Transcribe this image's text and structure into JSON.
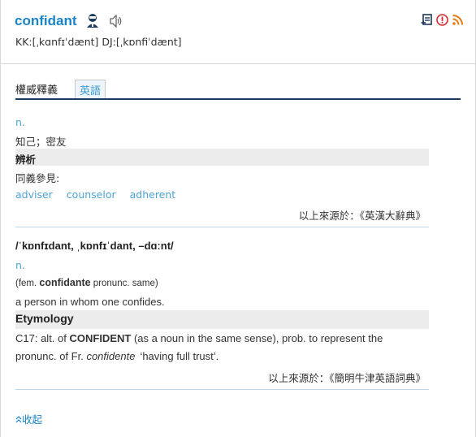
{
  "header": {
    "word": "confidant",
    "pronunciation": "KK:[ˌkɑnfɪˈdænt] DJ:[ˌkɒnfiˈdænt]",
    "icons": [
      "person-voice-icon",
      "speaker-icon",
      "add-to-list-icon",
      "report-icon",
      "rss-icon"
    ],
    "accent": "#1a84c7"
  },
  "tabs": {
    "active": "權威釋義",
    "english": "英語"
  },
  "entry1": {
    "pos": "n.",
    "definition": "知己；密友",
    "section_label": "辨析",
    "syn_label": "同義參見:",
    "synonyms": [
      "adviser",
      "counselor",
      "adherent"
    ],
    "source": "以上來源於：《英漢大辭典》"
  },
  "entry2": {
    "ipa": "/ˈkɒnfɪdant, ˌkɒnfɪˈdant, –dɑːnt/",
    "pos": "n.",
    "fem_open": "(fem. ",
    "fem_word": "confidante",
    "fem_close": " pronunc. same)",
    "definition": "a person in whom one confides.",
    "etym_label": "Etymology",
    "etym_p1": "C17: alt. of ",
    "etym_p2": "CONFIDENT",
    "etym_p3": " (as a noun in the same sense), prob. to represent the",
    "etym_p4": "pronunc. of Fr. ",
    "etym_p5": "confidente",
    "etym_p6": "‘having full trust’.",
    "source": "以上來源於：《簡明牛津英語詞典》"
  },
  "footer": {
    "collapse": "收起"
  }
}
